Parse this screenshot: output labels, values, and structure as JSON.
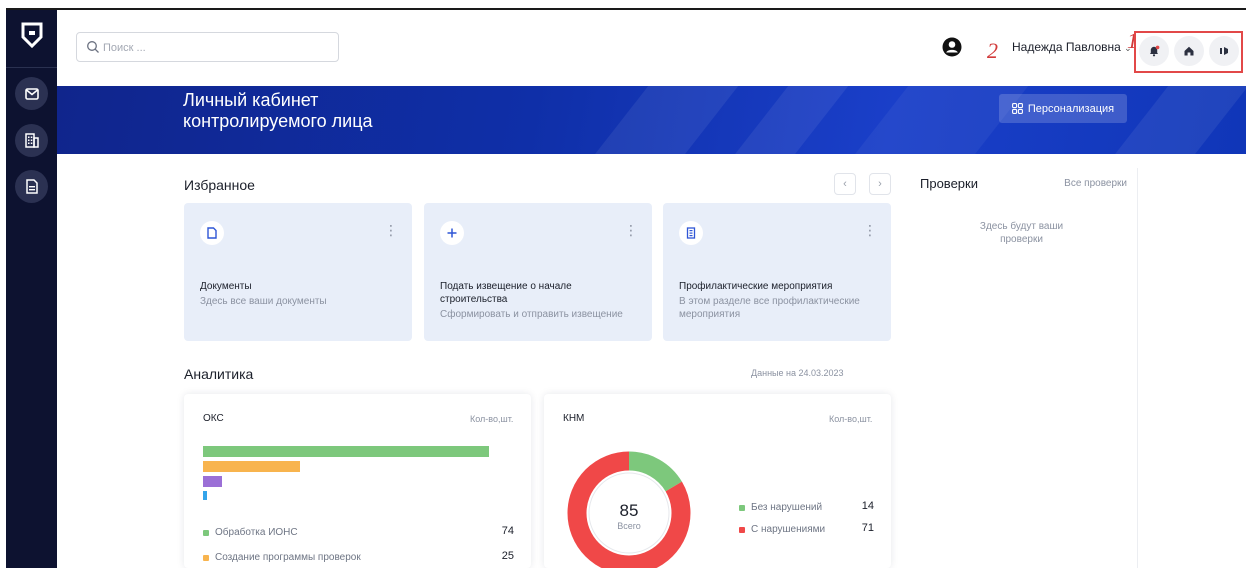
{
  "search": {
    "placeholder": "Поиск ..."
  },
  "header": {
    "user_name": "Надежда Павловна",
    "annotation_1": "1",
    "annotation_2": "2"
  },
  "banner": {
    "title_line1": "Личный кабинет",
    "title_line2": "контролируемого лица",
    "personalize_label": "Персонализация"
  },
  "favorites": {
    "title": "Избранное",
    "prev_icon": "chevron-left-icon",
    "next_icon": "chevron-right-icon",
    "cards": [
      {
        "icon": "document-icon",
        "title": "Документы",
        "subtitle": "Здесь все ваши документы"
      },
      {
        "icon": "plus-icon",
        "title": "Подать извещение о начале строительства",
        "subtitle": "Сформировать и отправить извещение"
      },
      {
        "icon": "building-icon",
        "title": "Профилактические мероприятия",
        "subtitle": "В этом разделе все профилактические мероприятия"
      }
    ]
  },
  "checks": {
    "title": "Проверки",
    "all_link": "Все проверки",
    "empty_text": "Здесь будут ваши проверки"
  },
  "analytics": {
    "title": "Аналитика",
    "date_note": "Данные на 24.03.2023",
    "oks": {
      "title": "ОКС",
      "unit": "Кол-во,шт.",
      "items": [
        {
          "label": "Обработка ИОНС",
          "value": 74,
          "color": "#7dc87c"
        },
        {
          "label": "Создание программы проверок",
          "value": 25,
          "color": "#f8b44e"
        },
        {
          "label": "",
          "value": 5,
          "color": "#9b6fd6"
        },
        {
          "label": "",
          "value": 1,
          "color": "#34a4ea"
        }
      ]
    },
    "knm": {
      "title": "КНМ",
      "unit": "Кол-во,шт.",
      "total": "85",
      "total_label": "Всего",
      "items": [
        {
          "label": "Без нарушений",
          "value": 14,
          "color": "#7dc87c"
        },
        {
          "label": "С нарушениями",
          "value": 71,
          "color": "#f04848"
        }
      ]
    }
  },
  "colors": {
    "rail_bg": "#0d1230",
    "banner_bg": "#0f2fa8",
    "card_bg": "#e8eef9",
    "annotation_red": "#e24848"
  }
}
